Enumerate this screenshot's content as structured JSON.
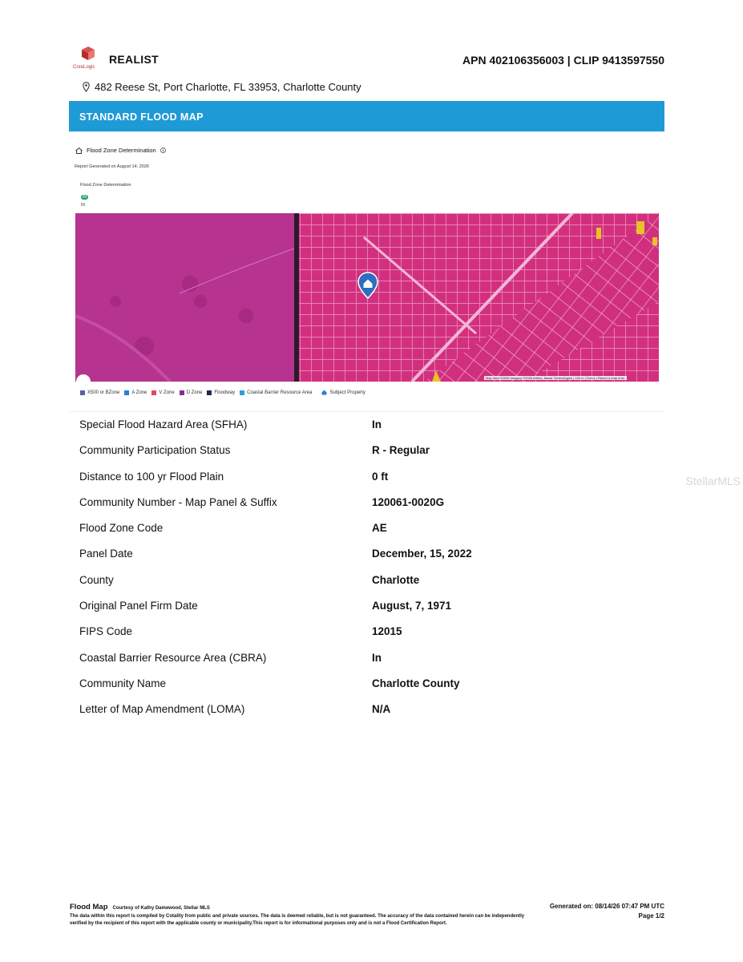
{
  "header": {
    "brand": "REALIST",
    "logo_text": "CoreLogic",
    "apn_clip": "APN 402106356003 | CLIP 9413597550",
    "address": "482 Reese St, Port Charlotte, FL 33953, Charlotte County"
  },
  "banner": {
    "title": "STANDARD FLOOD MAP"
  },
  "flood_section": {
    "heading": "Flood Zone Determination",
    "report_generated": "Report Generated on August 14, 2026",
    "sub_heading": "Flood Zone Determination",
    "toggle_in_label": "IN",
    "toggle_out_label": "IN"
  },
  "map": {
    "icon": "home-pin-icon",
    "credit": "Map data ©2026 Imagery ©2026 Airbus, Maxar Technologies | 100 m | Terms | Report a map error"
  },
  "legend": [
    {
      "label": "X500 or BZone",
      "color": "#5a5fa8"
    },
    {
      "label": "A Zone",
      "color": "#2a7fd0"
    },
    {
      "label": "V Zone",
      "color": "#e04a5a"
    },
    {
      "label": "D Zone",
      "color": "#8a2a9a"
    },
    {
      "label": "Floodway",
      "color": "#1d2a5a"
    },
    {
      "label": "Coastal Barrier Resource Area",
      "color": "#2aa0d8"
    },
    {
      "label": "Subject Property",
      "color": "#2a7fd0"
    }
  ],
  "rows": [
    {
      "label": "Special Flood Hazard Area (SFHA)",
      "value": "In"
    },
    {
      "label": "Community Participation Status",
      "value": "R - Regular"
    },
    {
      "label": "Distance to 100 yr Flood Plain",
      "value": "0 ft"
    },
    {
      "label": "Community Number - Map Panel & Suffix",
      "value": "120061-0020G"
    },
    {
      "label": "Flood Zone Code",
      "value": "AE"
    },
    {
      "label": "Panel Date",
      "value": "December, 15, 2022"
    },
    {
      "label": "County",
      "value": "Charlotte"
    },
    {
      "label": "Original Panel Firm Date",
      "value": "August, 7, 1971"
    },
    {
      "label": "FIPS Code",
      "value": "12015"
    },
    {
      "label": "Coastal Barrier Resource Area (CBRA)",
      "value": "In"
    },
    {
      "label": "Community Name",
      "value": "Charlotte County"
    },
    {
      "label": "Letter of Map Amendment (LOMA)",
      "value": "N/A"
    }
  ],
  "watermark": "StellarMLS",
  "footer": {
    "title": "Flood Map",
    "courtesy": "Courtesy of Kathy Damewood, Stellar MLS",
    "disclaimer": "The data within this report is compiled by Cotality from public and private sources. The data is deemed reliable, but is not guaranteed. The accuracy of the data contained herein can be independently verified by the recipient of this report with the applicable county or municipality.This report is for informational purposes only and is not a Flood Certification Report.",
    "generated": "Generated on: 08/14/26 07:47 PM UTC",
    "page": "Page 1/2"
  }
}
